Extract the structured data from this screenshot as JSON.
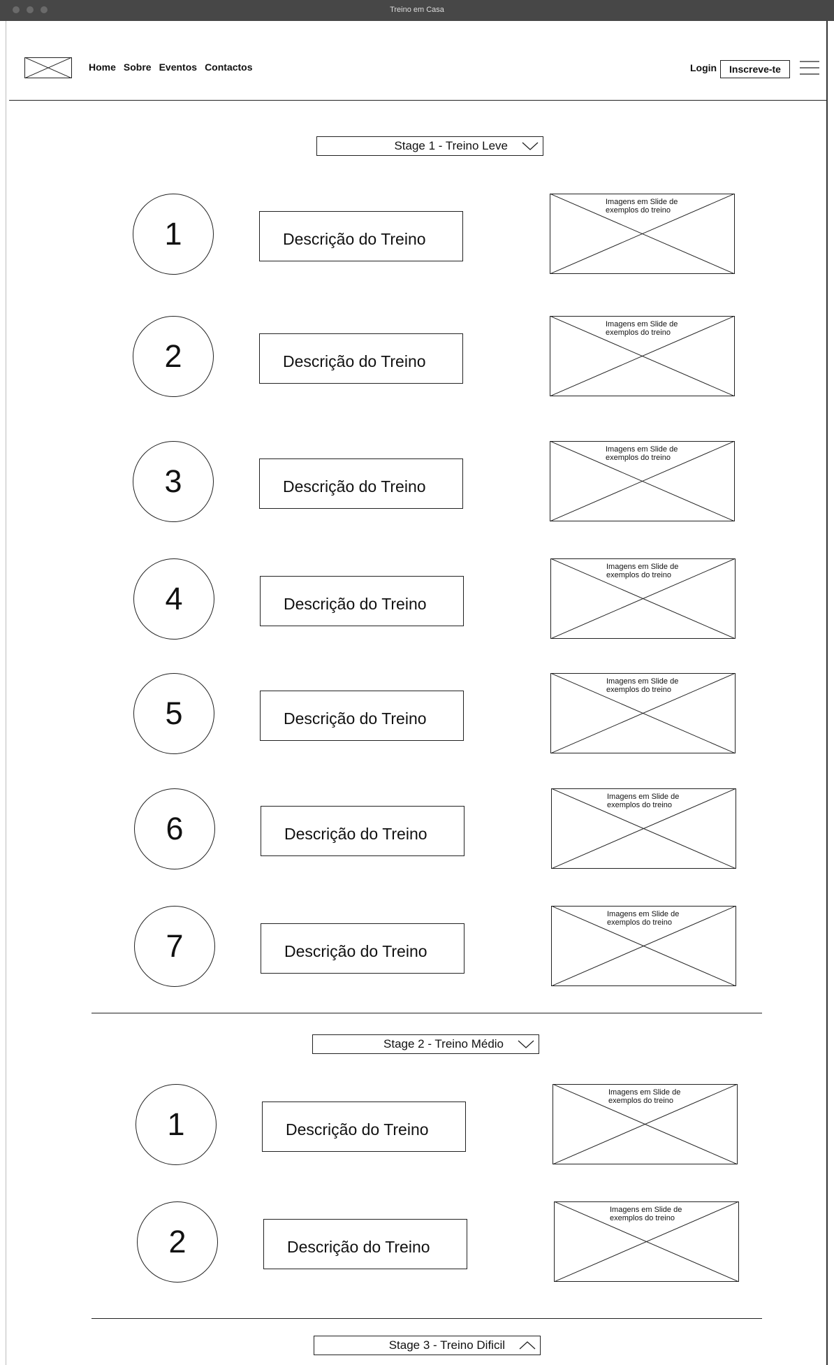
{
  "window": {
    "title": "Treino em Casa"
  },
  "nav": {
    "links": [
      "Home",
      "Sobre",
      "Eventos",
      "Contactos"
    ],
    "login": "Login",
    "signup": "Inscreve-te"
  },
  "stages": [
    {
      "label": "Stage 1 - Treino Leve",
      "chevron": "chevron-down-icon",
      "items": [
        {
          "number": "1",
          "description": "Descrição do Treino",
          "image_caption_1": "Imagens em Slide de",
          "image_caption_2": "exemplos do treino"
        },
        {
          "number": "2",
          "description": "Descrição do Treino",
          "image_caption_1": "Imagens em Slide de",
          "image_caption_2": "exemplos do treino"
        },
        {
          "number": "3",
          "description": "Descrição do Treino",
          "image_caption_1": "Imagens em Slide de",
          "image_caption_2": "exemplos do treino"
        },
        {
          "number": "4",
          "description": "Descrição do Treino",
          "image_caption_1": "Imagens em Slide de",
          "image_caption_2": "exemplos do treino"
        },
        {
          "number": "5",
          "description": "Descrição do Treino",
          "image_caption_1": "Imagens em Slide de",
          "image_caption_2": "exemplos do treino"
        },
        {
          "number": "6",
          "description": "Descrição do Treino",
          "image_caption_1": "Imagens em Slide de",
          "image_caption_2": "exemplos do treino"
        },
        {
          "number": "7",
          "description": "Descrição do Treino",
          "image_caption_1": "Imagens em Slide de",
          "image_caption_2": "exemplos do treino"
        }
      ]
    },
    {
      "label": "Stage 2 - Treino Médio",
      "chevron": "chevron-down-icon",
      "items": [
        {
          "number": "1",
          "description": "Descrição do Treino",
          "image_caption_1": "Imagens em Slide de",
          "image_caption_2": "exemplos do treino"
        },
        {
          "number": "2",
          "description": "Descrição do Treino",
          "image_caption_1": "Imagens em Slide de",
          "image_caption_2": "exemplos do treino"
        }
      ]
    },
    {
      "label": "Stage 3 - Treino Dificil",
      "chevron": "chevron-up-icon",
      "items": []
    }
  ]
}
